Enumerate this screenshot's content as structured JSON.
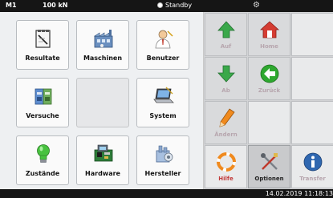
{
  "status_bar": {
    "machine": "M1",
    "force": "100 kN",
    "state": "Standby",
    "gear_icon": "gear-icon"
  },
  "tiles": [
    {
      "label": "Resultate",
      "icon": "notepad-icon"
    },
    {
      "label": "Maschinen",
      "icon": "factory-icon"
    },
    {
      "label": "Benutzer",
      "icon": "user-icon"
    },
    {
      "label": "Versuche",
      "icon": "binder-icon"
    },
    {
      "label": "",
      "icon": ""
    },
    {
      "label": "System",
      "icon": "laptop-icon"
    },
    {
      "label": "Zustände",
      "icon": "lightbulb-icon"
    },
    {
      "label": "Hardware",
      "icon": "circuit-board-icon"
    },
    {
      "label": "Hersteller",
      "icon": "manufacturer-icon"
    }
  ],
  "controls": {
    "up": "Auf",
    "home": "Home",
    "down": "Ab",
    "back": "Zurück",
    "edit": "Ändern",
    "help": "Hilfe",
    "options": "Optionen",
    "transfer": "Transfer"
  },
  "colors": {
    "green": "#3aa84a",
    "red": "#d43c32",
    "orange": "#f08a1e",
    "blue": "#2f67b0",
    "disabled_label": "#b7a6ae"
  },
  "datetime": "14.02.2019 11:18:13"
}
